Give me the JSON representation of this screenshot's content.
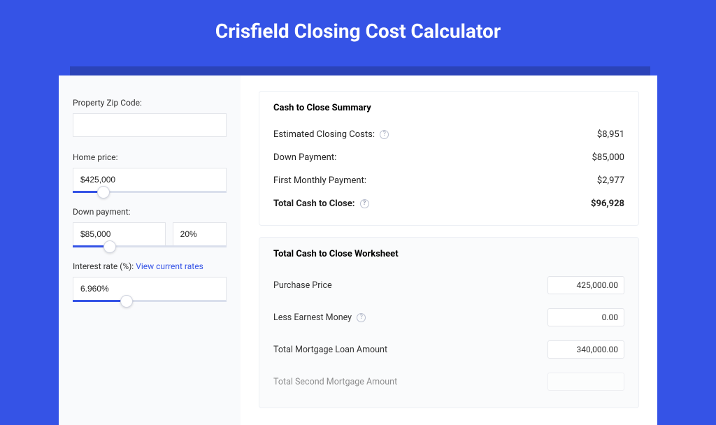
{
  "title": "Crisfield Closing Cost Calculator",
  "sidebar": {
    "zip_label": "Property Zip Code:",
    "zip_value": "",
    "home_label": "Home price:",
    "home_value": "$425,000",
    "dp_label": "Down payment:",
    "dp_value": "$85,000",
    "dp_pct": "20%",
    "rate_label": "Interest rate (%): ",
    "rate_link": "View current rates",
    "rate_value": "6.960%"
  },
  "summary": {
    "title": "Cash to Close Summary",
    "rows": [
      {
        "label": "Estimated Closing Costs:",
        "help": true,
        "value": "$8,951"
      },
      {
        "label": "Down Payment:",
        "help": false,
        "value": "$85,000"
      },
      {
        "label": "First Monthly Payment:",
        "help": false,
        "value": "$2,977"
      }
    ],
    "total_label": "Total Cash to Close:",
    "total_value": "$96,928"
  },
  "worksheet": {
    "title": "Total Cash to Close Worksheet",
    "rows": [
      {
        "label": "Purchase Price",
        "help": false,
        "value": "425,000.00"
      },
      {
        "label": "Less Earnest Money",
        "help": true,
        "value": "0.00"
      },
      {
        "label": "Total Mortgage Loan Amount",
        "help": false,
        "value": "340,000.00"
      },
      {
        "label": "Total Second Mortgage Amount",
        "help": false,
        "value": ""
      }
    ]
  }
}
